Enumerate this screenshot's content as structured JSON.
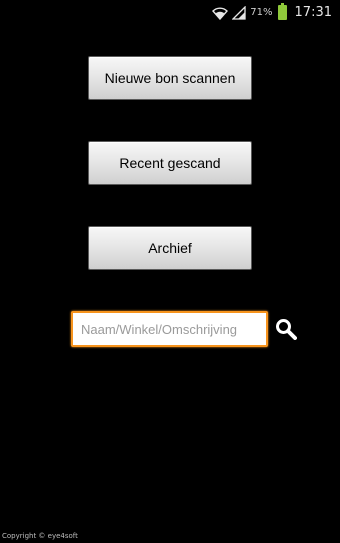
{
  "status_bar": {
    "battery_percent": "71%",
    "time": "17:31",
    "icons": [
      "wifi-icon",
      "signal-icon",
      "battery-icon"
    ],
    "battery_color": "#8fc93a"
  },
  "buttons": {
    "new_scan": "Nieuwe bon scannen",
    "recent": "Recent gescand",
    "archive": "Archief"
  },
  "search": {
    "value": "",
    "placeholder": "Naam/Winkel/Omschrijving",
    "focus_color": "#f7941d",
    "icon": "magnifier-icon"
  },
  "footer": {
    "copyright": "Copyright © eye4soft"
  }
}
